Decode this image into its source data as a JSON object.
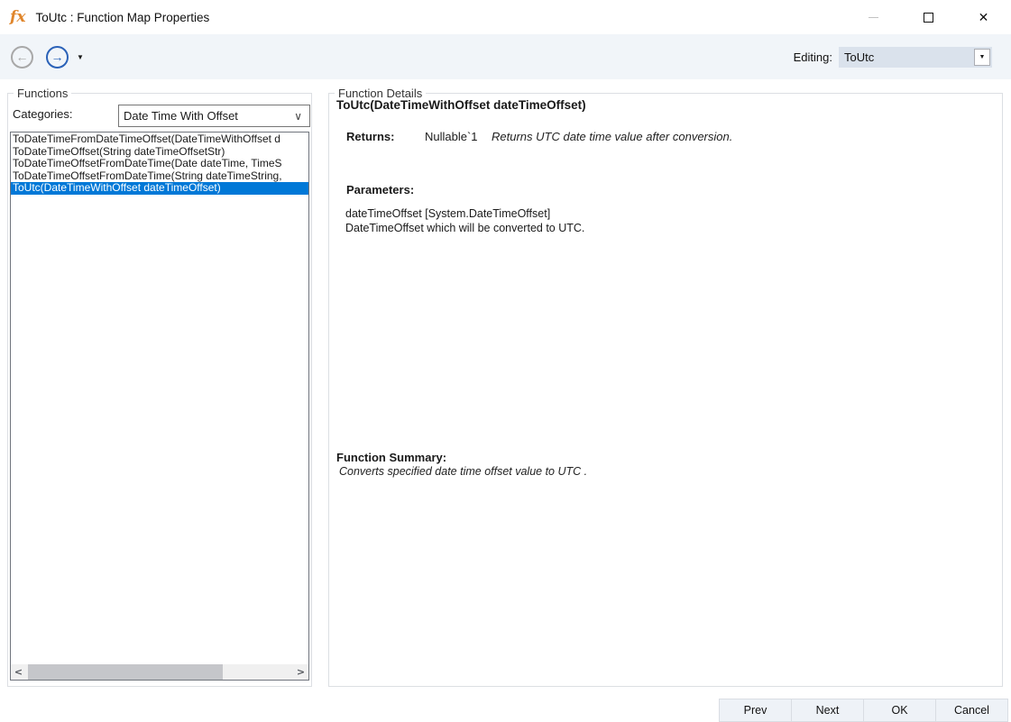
{
  "window": {
    "title": "ToUtc : Function Map Properties"
  },
  "icons": {
    "fx": "fx",
    "close": "✕",
    "back_arrow": "←",
    "forward_arrow": "→",
    "caret_down": "▼",
    "combo_arrow": "▼",
    "chevron_down": "∨",
    "scroll_left": "<",
    "scroll_right": ">"
  },
  "toolbar": {
    "editing_label": "Editing:",
    "editing_value": "ToUtc"
  },
  "functions_panel": {
    "title": "Functions",
    "categories_label": "Categories:",
    "categories_value": "Date Time With Offset",
    "selected_index": 4,
    "items": [
      "ToDateTimeFromDateTimeOffset(DateTimeWithOffset d",
      "ToDateTimeOffset(String dateTimeOffsetStr)",
      "ToDateTimeOffsetFromDateTime(Date dateTime, TimeS",
      "ToDateTimeOffsetFromDateTime(String dateTimeString,",
      "ToUtc(DateTimeWithOffset dateTimeOffset)"
    ]
  },
  "details_panel": {
    "title": "Function Details",
    "signature": "ToUtc(DateTimeWithOffset dateTimeOffset)",
    "returns_label": "Returns:",
    "returns_type": "Nullable`1",
    "returns_desc": "Returns UTC date time value after conversion.",
    "parameters_label": "Parameters:",
    "parameter_name": "dateTimeOffset [System.DateTimeOffset]",
    "parameter_desc": "DateTimeOffset which will be converted to UTC.",
    "summary_label": "Function Summary:",
    "summary_text": "Converts specified date time offset value to UTC ."
  },
  "footer": {
    "prev": "Prev",
    "next": "Next",
    "ok": "OK",
    "cancel": "Cancel"
  },
  "colors": {
    "selection_blue": "#0078d7",
    "toolbar_bg": "#f1f5f9",
    "accent_orange": "#e0862c",
    "nav_blue": "#2b62b8"
  }
}
